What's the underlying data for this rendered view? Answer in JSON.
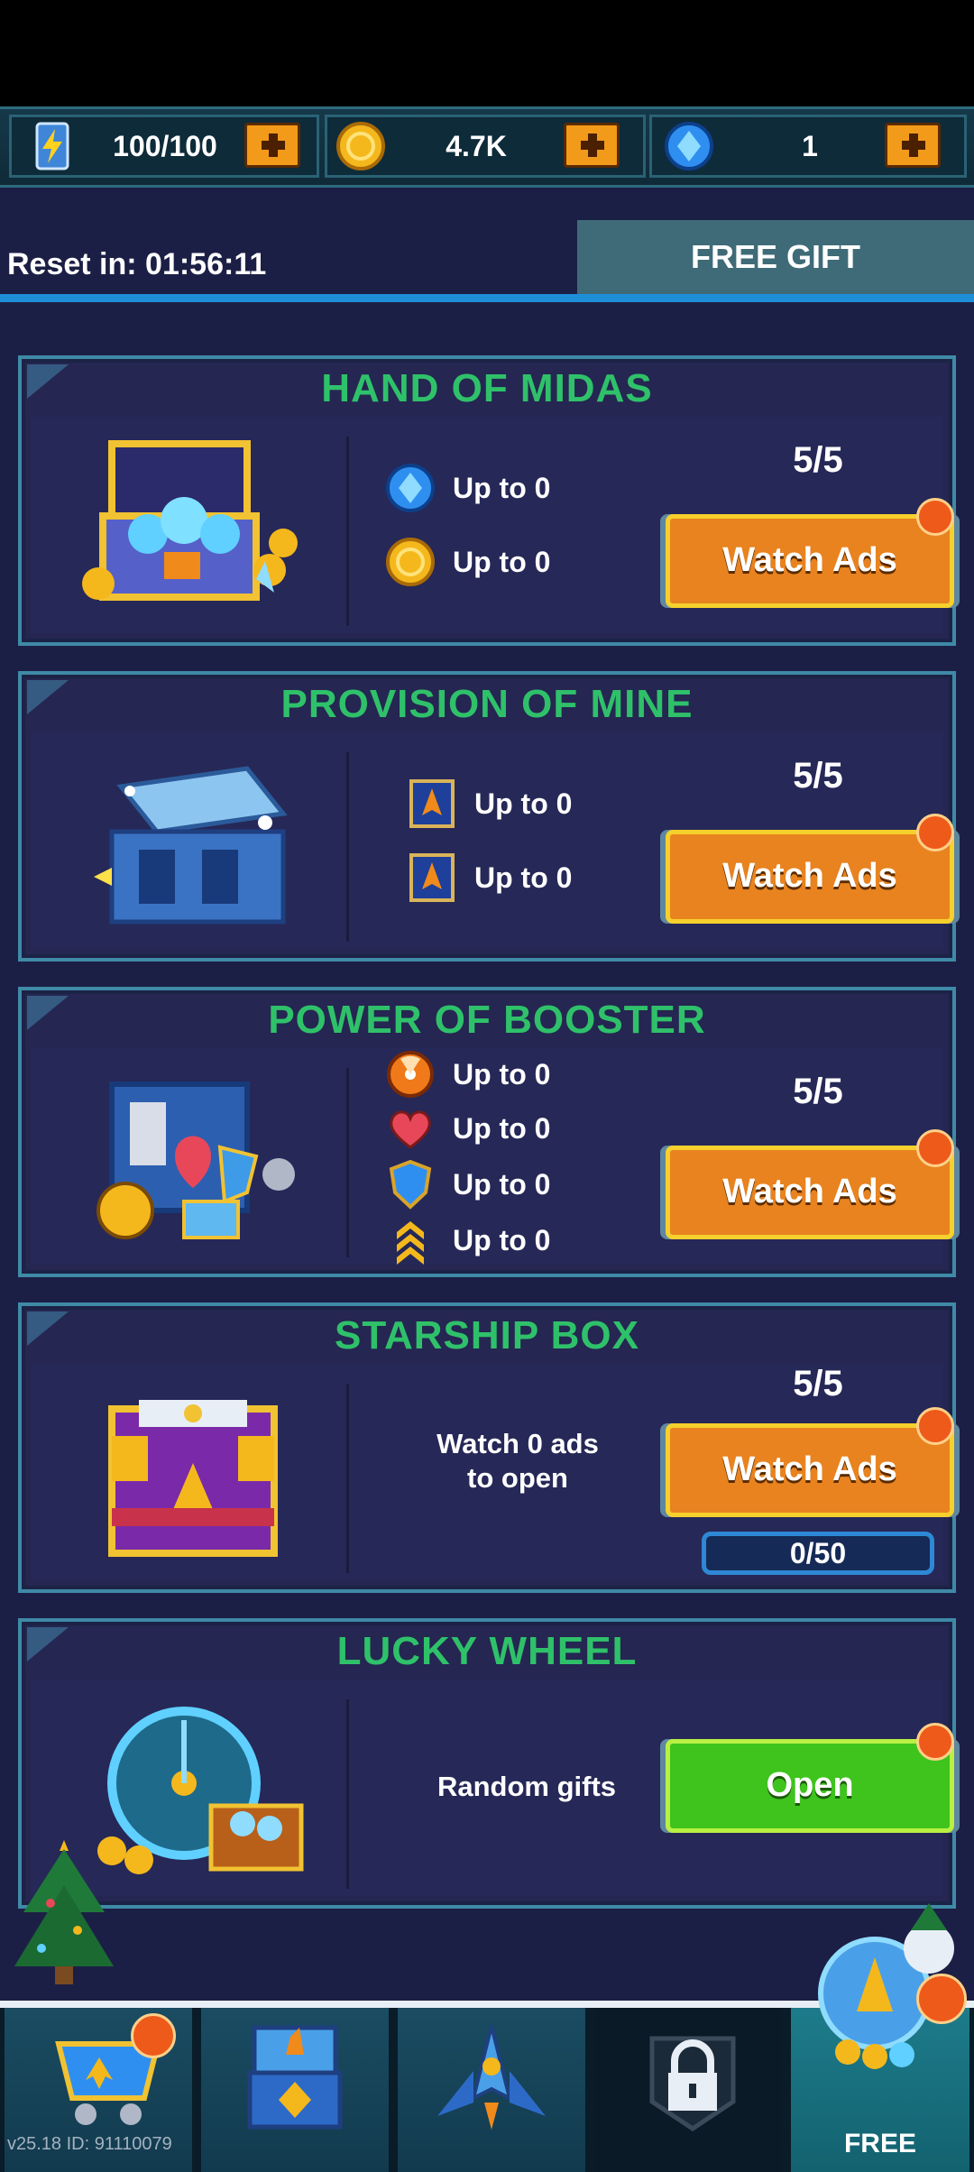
{
  "currency": {
    "energy": "100/100",
    "coins": "4.7K",
    "gems": "1"
  },
  "reset": {
    "label": "Reset in: 01:56:11",
    "tab_label": "FREE GIFT"
  },
  "cards": [
    {
      "title": "HAND OF MIDAS",
      "counter": "5/5",
      "button": "Watch Ads",
      "rewards": [
        {
          "icon": "gem-icon",
          "text": "Up to 0"
        },
        {
          "icon": "coin-icon",
          "text": "Up to 0"
        }
      ]
    },
    {
      "title": "PROVISION OF MINE",
      "counter": "5/5",
      "button": "Watch Ads",
      "rewards": [
        {
          "icon": "ship-card-icon",
          "text": "Up to 0"
        },
        {
          "icon": "ship-card-icon",
          "text": "Up to 0"
        }
      ]
    },
    {
      "title": "POWER OF BOOSTER",
      "counter": "5/5",
      "button": "Watch Ads",
      "rewards": [
        {
          "icon": "nuke-icon",
          "text": "Up to 0"
        },
        {
          "icon": "heart-icon",
          "text": "Up to 0"
        },
        {
          "icon": "shield-icon",
          "text": "Up to 0"
        },
        {
          "icon": "rank-chevron-icon",
          "text": "Up to 0"
        }
      ]
    },
    {
      "title": "STARSHIP BOX",
      "counter": "5/5",
      "button": "Watch Ads",
      "line1": "Watch 0 ads",
      "line2": "to open",
      "progress": "0/50"
    },
    {
      "title": "LUCKY WHEEL",
      "button": "Open",
      "description": "Random gifts"
    }
  ],
  "nav": {
    "shop": "shop-cart-icon",
    "chest": "chest-icon",
    "ship": "spaceship-icon",
    "locked": "lock-icon",
    "free_label": "FREE"
  },
  "version": "v25.18 ID: 91110079",
  "colors": {
    "title_green": "#2fc16a",
    "button_orange": "#e8831f",
    "button_green": "#3ec41c",
    "badge": "#ee5a1a"
  }
}
